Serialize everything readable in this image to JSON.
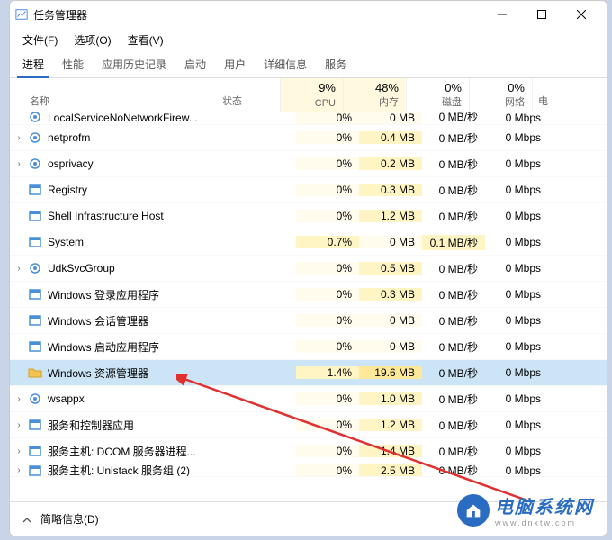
{
  "window": {
    "title": "任务管理器"
  },
  "menu": {
    "file": "文件(F)",
    "options": "选项(O)",
    "view": "查看(V)"
  },
  "tabs": [
    "进程",
    "性能",
    "应用历史记录",
    "启动",
    "用户",
    "详细信息",
    "服务"
  ],
  "activeTab": 0,
  "headers": {
    "name": "名称",
    "status": "状态",
    "extra": "电",
    "cols": [
      {
        "value": "9%",
        "label": "CPU"
      },
      {
        "value": "48%",
        "label": "内存"
      },
      {
        "value": "0%",
        "label": "磁盘"
      },
      {
        "value": "0%",
        "label": "网络"
      }
    ]
  },
  "processes": [
    {
      "exp": false,
      "icon": "gear",
      "name": "LocalServiceNoNetworkFirew...",
      "cpu": "0%",
      "mem": "0 MB",
      "disk": "0 MB/秒",
      "net": "0 Mbps",
      "memTint": 1,
      "cpuTint": 1,
      "cut": true
    },
    {
      "exp": true,
      "icon": "gear",
      "name": "netprofm",
      "cpu": "0%",
      "mem": "0.4 MB",
      "disk": "0 MB/秒",
      "net": "0 Mbps",
      "memTint": 2,
      "cpuTint": 1
    },
    {
      "exp": true,
      "icon": "gear",
      "name": "osprivacy",
      "cpu": "0%",
      "mem": "0.2 MB",
      "disk": "0 MB/秒",
      "net": "0 Mbps",
      "memTint": 2,
      "cpuTint": 1
    },
    {
      "exp": false,
      "icon": "square",
      "name": "Registry",
      "cpu": "0%",
      "mem": "0.3 MB",
      "disk": "0 MB/秒",
      "net": "0 Mbps",
      "memTint": 2,
      "cpuTint": 1
    },
    {
      "exp": false,
      "icon": "square",
      "name": "Shell Infrastructure Host",
      "cpu": "0%",
      "mem": "1.2 MB",
      "disk": "0 MB/秒",
      "net": "0 Mbps",
      "memTint": 2,
      "cpuTint": 1
    },
    {
      "exp": false,
      "icon": "square",
      "name": "System",
      "cpu": "0.7%",
      "mem": "0 MB",
      "disk": "0.1 MB/秒",
      "net": "0 Mbps",
      "memTint": 1,
      "cpuTint": 2,
      "diskTint": 2
    },
    {
      "exp": true,
      "icon": "gear",
      "name": "UdkSvcGroup",
      "cpu": "0%",
      "mem": "0.5 MB",
      "disk": "0 MB/秒",
      "net": "0 Mbps",
      "memTint": 2,
      "cpuTint": 1
    },
    {
      "exp": false,
      "icon": "square",
      "name": "Windows 登录应用程序",
      "cpu": "0%",
      "mem": "0.3 MB",
      "disk": "0 MB/秒",
      "net": "0 Mbps",
      "memTint": 2,
      "cpuTint": 1
    },
    {
      "exp": false,
      "icon": "square",
      "name": "Windows 会话管理器",
      "cpu": "0%",
      "mem": "0 MB",
      "disk": "0 MB/秒",
      "net": "0 Mbps",
      "memTint": 1,
      "cpuTint": 1
    },
    {
      "exp": false,
      "icon": "square",
      "name": "Windows 启动应用程序",
      "cpu": "0%",
      "mem": "0 MB",
      "disk": "0 MB/秒",
      "net": "0 Mbps",
      "memTint": 1,
      "cpuTint": 1
    },
    {
      "exp": false,
      "icon": "folder",
      "name": "Windows 资源管理器",
      "cpu": "1.4%",
      "mem": "19.6 MB",
      "disk": "0 MB/秒",
      "net": "0 Mbps",
      "memTint": 3,
      "cpuTint": 2,
      "selected": true
    },
    {
      "exp": true,
      "icon": "gear",
      "name": "wsappx",
      "cpu": "0%",
      "mem": "1.0 MB",
      "disk": "0 MB/秒",
      "net": "0 Mbps",
      "memTint": 2,
      "cpuTint": 1
    },
    {
      "exp": true,
      "icon": "square",
      "name": "服务和控制器应用",
      "cpu": "0%",
      "mem": "1.2 MB",
      "disk": "0 MB/秒",
      "net": "0 Mbps",
      "memTint": 2,
      "cpuTint": 1
    },
    {
      "exp": true,
      "icon": "square",
      "name": "服务主机: DCOM 服务器进程...",
      "cpu": "0%",
      "mem": "1.4 MB",
      "disk": "0 MB/秒",
      "net": "0 Mbps",
      "memTint": 2,
      "cpuTint": 1
    },
    {
      "exp": true,
      "icon": "square",
      "name": "服务主机: Unistack 服务组 (2)",
      "cpu": "0%",
      "mem": "2.5 MB",
      "disk": "0 MB/秒",
      "net": "0 Mbps",
      "memTint": 2,
      "cpuTint": 1,
      "cut": true
    }
  ],
  "footer": {
    "label": "简略信息(D)"
  },
  "logo": {
    "text": "电脑系统网",
    "sub": "www.dnxtw.com"
  }
}
